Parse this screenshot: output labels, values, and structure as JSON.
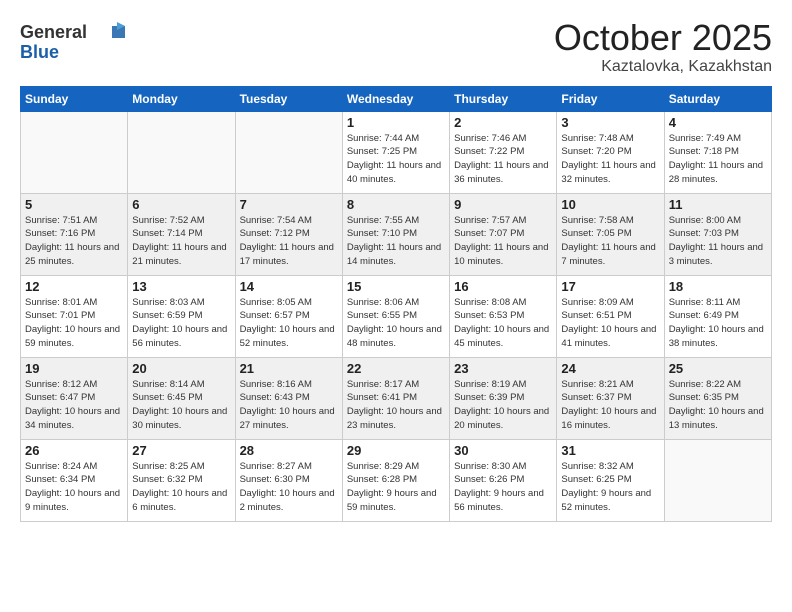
{
  "header": {
    "logo_line1": "General",
    "logo_line2": "Blue",
    "month": "October 2025",
    "location": "Kaztalovka, Kazakhstan"
  },
  "weekdays": [
    "Sunday",
    "Monday",
    "Tuesday",
    "Wednesday",
    "Thursday",
    "Friday",
    "Saturday"
  ],
  "weeks": [
    {
      "shaded": false,
      "days": [
        {
          "num": "",
          "sunrise": "",
          "sunset": "",
          "daylight": ""
        },
        {
          "num": "",
          "sunrise": "",
          "sunset": "",
          "daylight": ""
        },
        {
          "num": "",
          "sunrise": "",
          "sunset": "",
          "daylight": ""
        },
        {
          "num": "1",
          "sunrise": "Sunrise: 7:44 AM",
          "sunset": "Sunset: 7:25 PM",
          "daylight": "Daylight: 11 hours and 40 minutes."
        },
        {
          "num": "2",
          "sunrise": "Sunrise: 7:46 AM",
          "sunset": "Sunset: 7:22 PM",
          "daylight": "Daylight: 11 hours and 36 minutes."
        },
        {
          "num": "3",
          "sunrise": "Sunrise: 7:48 AM",
          "sunset": "Sunset: 7:20 PM",
          "daylight": "Daylight: 11 hours and 32 minutes."
        },
        {
          "num": "4",
          "sunrise": "Sunrise: 7:49 AM",
          "sunset": "Sunset: 7:18 PM",
          "daylight": "Daylight: 11 hours and 28 minutes."
        }
      ]
    },
    {
      "shaded": true,
      "days": [
        {
          "num": "5",
          "sunrise": "Sunrise: 7:51 AM",
          "sunset": "Sunset: 7:16 PM",
          "daylight": "Daylight: 11 hours and 25 minutes."
        },
        {
          "num": "6",
          "sunrise": "Sunrise: 7:52 AM",
          "sunset": "Sunset: 7:14 PM",
          "daylight": "Daylight: 11 hours and 21 minutes."
        },
        {
          "num": "7",
          "sunrise": "Sunrise: 7:54 AM",
          "sunset": "Sunset: 7:12 PM",
          "daylight": "Daylight: 11 hours and 17 minutes."
        },
        {
          "num": "8",
          "sunrise": "Sunrise: 7:55 AM",
          "sunset": "Sunset: 7:10 PM",
          "daylight": "Daylight: 11 hours and 14 minutes."
        },
        {
          "num": "9",
          "sunrise": "Sunrise: 7:57 AM",
          "sunset": "Sunset: 7:07 PM",
          "daylight": "Daylight: 11 hours and 10 minutes."
        },
        {
          "num": "10",
          "sunrise": "Sunrise: 7:58 AM",
          "sunset": "Sunset: 7:05 PM",
          "daylight": "Daylight: 11 hours and 7 minutes."
        },
        {
          "num": "11",
          "sunrise": "Sunrise: 8:00 AM",
          "sunset": "Sunset: 7:03 PM",
          "daylight": "Daylight: 11 hours and 3 minutes."
        }
      ]
    },
    {
      "shaded": false,
      "days": [
        {
          "num": "12",
          "sunrise": "Sunrise: 8:01 AM",
          "sunset": "Sunset: 7:01 PM",
          "daylight": "Daylight: 10 hours and 59 minutes."
        },
        {
          "num": "13",
          "sunrise": "Sunrise: 8:03 AM",
          "sunset": "Sunset: 6:59 PM",
          "daylight": "Daylight: 10 hours and 56 minutes."
        },
        {
          "num": "14",
          "sunrise": "Sunrise: 8:05 AM",
          "sunset": "Sunset: 6:57 PM",
          "daylight": "Daylight: 10 hours and 52 minutes."
        },
        {
          "num": "15",
          "sunrise": "Sunrise: 8:06 AM",
          "sunset": "Sunset: 6:55 PM",
          "daylight": "Daylight: 10 hours and 48 minutes."
        },
        {
          "num": "16",
          "sunrise": "Sunrise: 8:08 AM",
          "sunset": "Sunset: 6:53 PM",
          "daylight": "Daylight: 10 hours and 45 minutes."
        },
        {
          "num": "17",
          "sunrise": "Sunrise: 8:09 AM",
          "sunset": "Sunset: 6:51 PM",
          "daylight": "Daylight: 10 hours and 41 minutes."
        },
        {
          "num": "18",
          "sunrise": "Sunrise: 8:11 AM",
          "sunset": "Sunset: 6:49 PM",
          "daylight": "Daylight: 10 hours and 38 minutes."
        }
      ]
    },
    {
      "shaded": true,
      "days": [
        {
          "num": "19",
          "sunrise": "Sunrise: 8:12 AM",
          "sunset": "Sunset: 6:47 PM",
          "daylight": "Daylight: 10 hours and 34 minutes."
        },
        {
          "num": "20",
          "sunrise": "Sunrise: 8:14 AM",
          "sunset": "Sunset: 6:45 PM",
          "daylight": "Daylight: 10 hours and 30 minutes."
        },
        {
          "num": "21",
          "sunrise": "Sunrise: 8:16 AM",
          "sunset": "Sunset: 6:43 PM",
          "daylight": "Daylight: 10 hours and 27 minutes."
        },
        {
          "num": "22",
          "sunrise": "Sunrise: 8:17 AM",
          "sunset": "Sunset: 6:41 PM",
          "daylight": "Daylight: 10 hours and 23 minutes."
        },
        {
          "num": "23",
          "sunrise": "Sunrise: 8:19 AM",
          "sunset": "Sunset: 6:39 PM",
          "daylight": "Daylight: 10 hours and 20 minutes."
        },
        {
          "num": "24",
          "sunrise": "Sunrise: 8:21 AM",
          "sunset": "Sunset: 6:37 PM",
          "daylight": "Daylight: 10 hours and 16 minutes."
        },
        {
          "num": "25",
          "sunrise": "Sunrise: 8:22 AM",
          "sunset": "Sunset: 6:35 PM",
          "daylight": "Daylight: 10 hours and 13 minutes."
        }
      ]
    },
    {
      "shaded": false,
      "days": [
        {
          "num": "26",
          "sunrise": "Sunrise: 8:24 AM",
          "sunset": "Sunset: 6:34 PM",
          "daylight": "Daylight: 10 hours and 9 minutes."
        },
        {
          "num": "27",
          "sunrise": "Sunrise: 8:25 AM",
          "sunset": "Sunset: 6:32 PM",
          "daylight": "Daylight: 10 hours and 6 minutes."
        },
        {
          "num": "28",
          "sunrise": "Sunrise: 8:27 AM",
          "sunset": "Sunset: 6:30 PM",
          "daylight": "Daylight: 10 hours and 2 minutes."
        },
        {
          "num": "29",
          "sunrise": "Sunrise: 8:29 AM",
          "sunset": "Sunset: 6:28 PM",
          "daylight": "Daylight: 9 hours and 59 minutes."
        },
        {
          "num": "30",
          "sunrise": "Sunrise: 8:30 AM",
          "sunset": "Sunset: 6:26 PM",
          "daylight": "Daylight: 9 hours and 56 minutes."
        },
        {
          "num": "31",
          "sunrise": "Sunrise: 8:32 AM",
          "sunset": "Sunset: 6:25 PM",
          "daylight": "Daylight: 9 hours and 52 minutes."
        },
        {
          "num": "",
          "sunrise": "",
          "sunset": "",
          "daylight": ""
        }
      ]
    }
  ]
}
